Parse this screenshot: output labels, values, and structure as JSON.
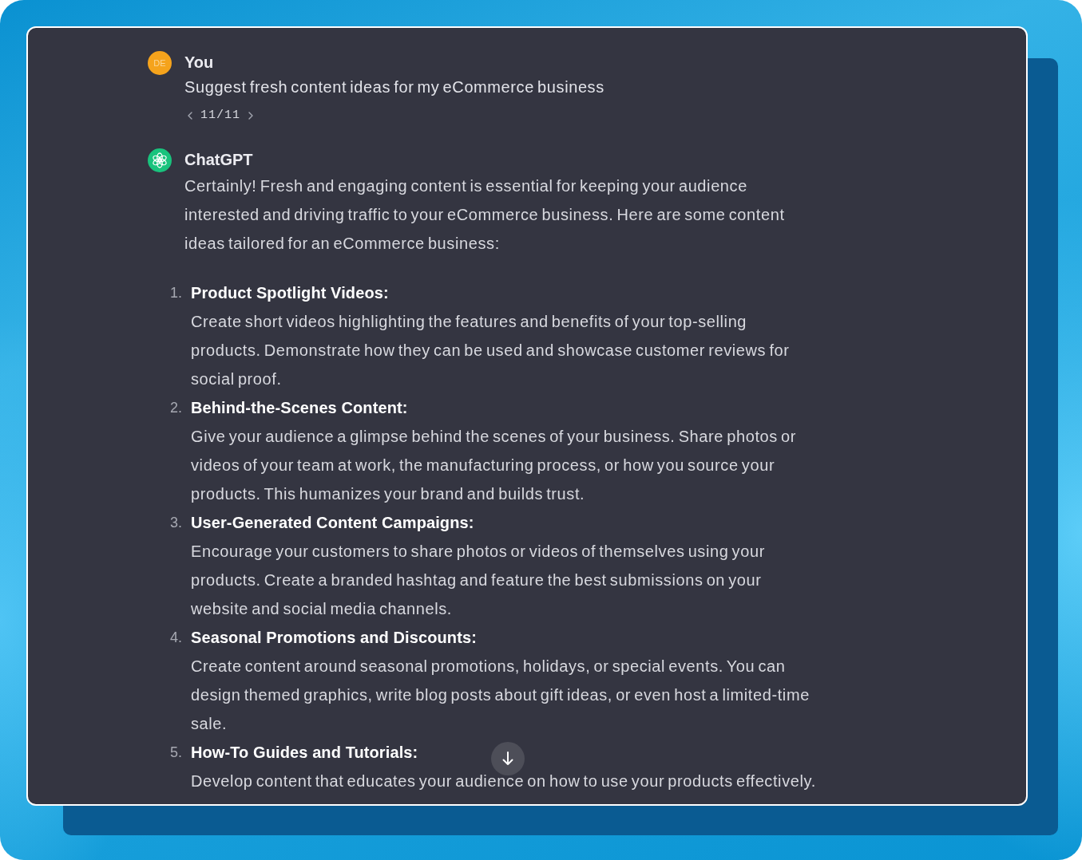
{
  "user_message": {
    "avatar_initials": "DE",
    "author": "You",
    "text": "Suggest fresh content ideas for my eCommerce business",
    "pager": {
      "count": "11/11"
    }
  },
  "assistant_message": {
    "author": "ChatGPT",
    "intro": "Certainly! Fresh and engaging content is essential for keeping your audience interested and driving traffic to your eCommerce business. Here are some content ideas tailored for an eCommerce business:",
    "items": [
      {
        "number": "1.",
        "title": "Product Spotlight Videos:",
        "body": "Create short videos highlighting the features and benefits of your top-selling products. Demonstrate how they can be used and showcase customer reviews for social proof."
      },
      {
        "number": "2.",
        "title": "Behind-the-Scenes Content:",
        "body": "Give your audience a glimpse behind the scenes of your business. Share photos or videos of your team at work, the manufacturing process, or how you source your products. This humanizes your brand and builds trust."
      },
      {
        "number": "3.",
        "title": "User-Generated Content Campaigns:",
        "body": "Encourage your customers to share photos or videos of themselves using your products. Create a branded hashtag and feature the best submissions on your website and social media channels."
      },
      {
        "number": "4.",
        "title": "Seasonal Promotions and Discounts:",
        "body": "Create content around seasonal promotions, holidays, or special events. You can design themed graphics, write blog posts about gift ideas, or even host a limited-time sale."
      },
      {
        "number": "5.",
        "title": "How-To Guides and Tutorials:",
        "body": "Develop content that educates your audience on how to use your products effectively."
      }
    ]
  }
}
